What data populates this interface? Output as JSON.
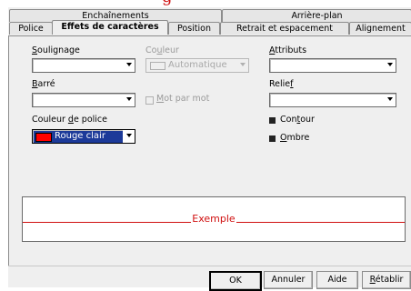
{
  "window": {
    "title_fragment": "g"
  },
  "tabs_row1": [
    {
      "label": "Enchaînements"
    },
    {
      "label": "Arrière-plan"
    }
  ],
  "tabs_row2": [
    {
      "label": "Police"
    },
    {
      "label": "Effets de caractères",
      "active": true
    },
    {
      "label": "Position"
    },
    {
      "label": "Retrait et espacement"
    },
    {
      "label": "Alignement"
    }
  ],
  "underline": {
    "label_first": "S",
    "label_rest": "oulignage",
    "value": ""
  },
  "color": {
    "label_pre": "Co",
    "label_u": "u",
    "label_post": "leur",
    "value": "Automatique"
  },
  "attributes": {
    "label_first": "A",
    "label_rest": "ttributs",
    "value": ""
  },
  "strikethrough": {
    "label_first": "B",
    "label_rest": "arré",
    "value": ""
  },
  "word_by_word": {
    "label_first": "M",
    "label_rest": "ot par mot",
    "checked": false
  },
  "relief": {
    "label_pre": "Relie",
    "label_u": "f",
    "value": ""
  },
  "font_color": {
    "label_pre": "Couleur ",
    "label_u": "d",
    "label_post": "e police",
    "value": "Rouge clair",
    "swatch": "#ff0000"
  },
  "outline": {
    "label_pre": "Con",
    "label_u": "t",
    "label_post": "our",
    "checked": true
  },
  "shadow": {
    "label_first": "O",
    "label_rest": "mbre",
    "checked": true
  },
  "preview": {
    "text": "Exemple",
    "color": "#d01010"
  },
  "buttons": {
    "ok": "OK",
    "cancel": "Annuler",
    "help": "Aide",
    "reset_first": "R",
    "reset_rest": "établir"
  },
  "colors": {
    "accent": "#1c3a99",
    "preview_red": "#d01010"
  }
}
